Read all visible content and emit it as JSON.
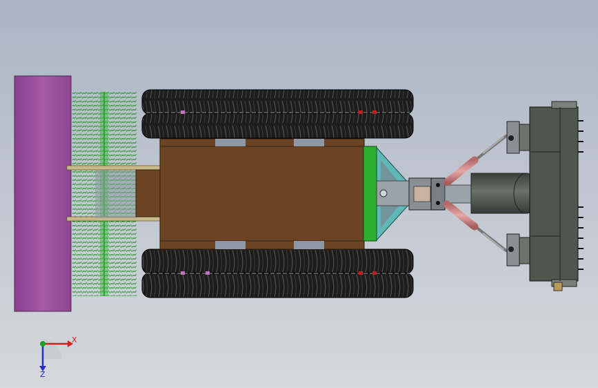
{
  "app": {
    "title": ""
  },
  "triad": {
    "x_label": "X",
    "z_label": "Z",
    "x_color": "#d02020",
    "y_color": "#20a020",
    "z_color": "#2030c0"
  },
  "colors": {
    "background_top": "#aab4c3",
    "background_bottom": "#d5d8dd",
    "roller": "#a050a0",
    "brush": "#3fbf3f",
    "chassis": "#6b4423",
    "track": "#1a1a1a",
    "plate": "#2fae2f",
    "frame": "#5fb8b8",
    "cylinder": "#d48a8a",
    "motor": "#4a504a",
    "blade": "#4d574d"
  }
}
